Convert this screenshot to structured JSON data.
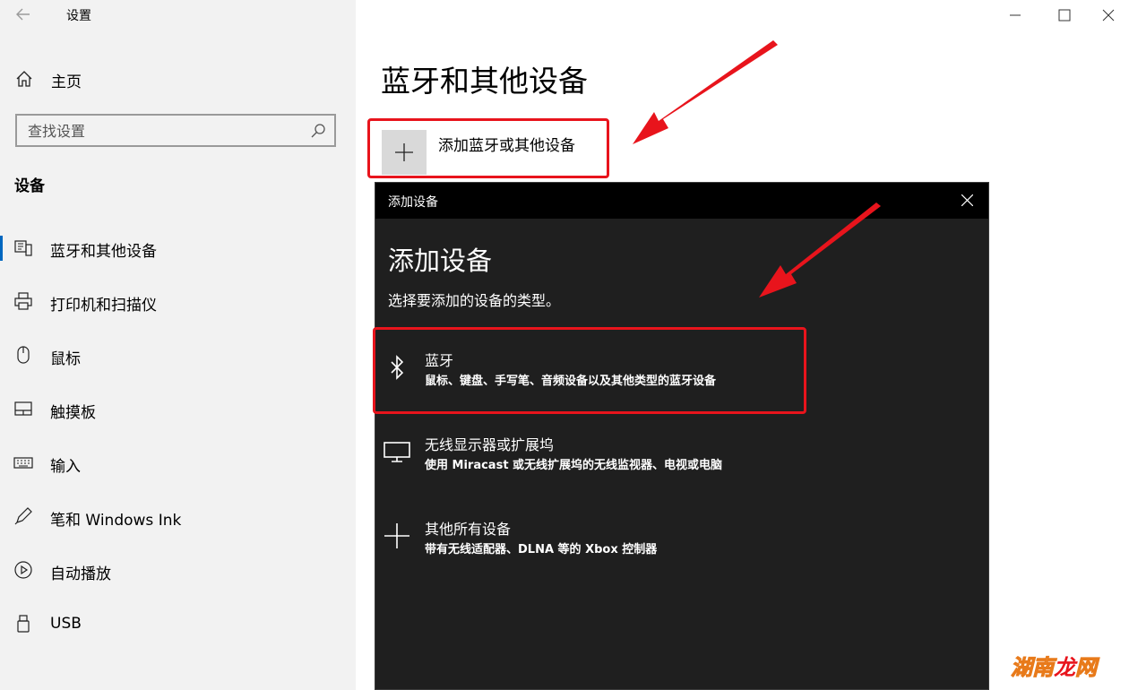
{
  "window": {
    "app_title": "设置"
  },
  "sidebar": {
    "home_label": "主页",
    "search_placeholder": "查找设置",
    "section_title": "设备",
    "items": [
      {
        "label": "蓝牙和其他设备",
        "icon": "bluetooth-devices-icon",
        "active": true
      },
      {
        "label": "打印机和扫描仪",
        "icon": "printer-icon"
      },
      {
        "label": "鼠标",
        "icon": "mouse-icon"
      },
      {
        "label": "触摸板",
        "icon": "touchpad-icon"
      },
      {
        "label": "输入",
        "icon": "keyboard-icon"
      },
      {
        "label": "笔和 Windows Ink",
        "icon": "pen-icon"
      },
      {
        "label": "自动播放",
        "icon": "autoplay-icon"
      },
      {
        "label": "USB",
        "icon": "usb-icon"
      }
    ]
  },
  "main": {
    "page_title": "蓝牙和其他设备",
    "add_button_label": "添加蓝牙或其他设备"
  },
  "dialog": {
    "titlebar": "添加设备",
    "heading": "添加设备",
    "subtitle": "选择要添加的设备的类型。",
    "options": [
      {
        "name": "蓝牙",
        "desc": "鼠标、键盘、手写笔、音频设备以及其他类型的蓝牙设备",
        "icon": "bluetooth-icon"
      },
      {
        "name": "无线显示器或扩展坞",
        "desc": "使用 Miracast 或无线扩展坞的无线监视器、电视或电脑",
        "icon": "monitor-icon"
      },
      {
        "name": "其他所有设备",
        "desc": "带有无线适配器、DLNA 等的 Xbox 控制器",
        "icon": "plus-icon"
      }
    ]
  },
  "watermark": {
    "text_a": "湖南",
    "text_b": "龙",
    "text_c": "网"
  },
  "colors": {
    "accent": "#0067c0",
    "annotation_red": "#e8141c",
    "dialog_bg": "#1f1f1f"
  }
}
